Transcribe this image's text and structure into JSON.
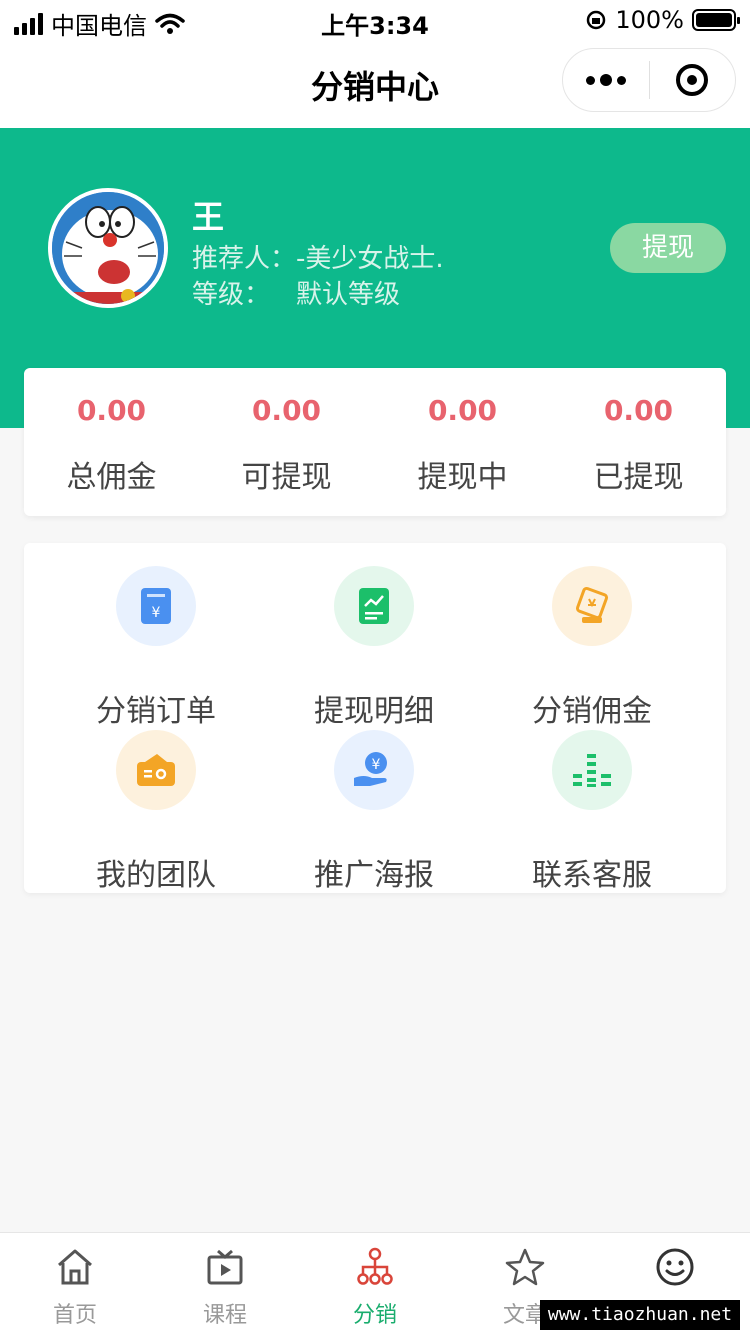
{
  "status_bar": {
    "carrier": "中国电信",
    "time": "上午3:34",
    "battery": "100%"
  },
  "nav": {
    "title": "分销中心"
  },
  "user": {
    "name": "王",
    "referrer_label": "推荐人：",
    "referrer": "-美少女战士.",
    "level_label": "等级：",
    "level": "默认等级",
    "withdraw_button": "提现"
  },
  "stats": [
    {
      "value": "0.00",
      "label": "总佣金"
    },
    {
      "value": "0.00",
      "label": "可提现"
    },
    {
      "value": "0.00",
      "label": "提现中"
    },
    {
      "value": "0.00",
      "label": "已提现"
    }
  ],
  "menu": [
    {
      "label": "分销订单",
      "icon": "order-yen-icon",
      "bg": "#e8f1fe",
      "color": "#4a90f0"
    },
    {
      "label": "提现明细",
      "icon": "chart-doc-icon",
      "bg": "#e4f7ec",
      "color": "#1cbf6a"
    },
    {
      "label": "分销佣金",
      "icon": "commission-card-icon",
      "bg": "#fdf1dd",
      "color": "#f3a526"
    },
    {
      "label": "我的团队",
      "icon": "wallet-icon",
      "bg": "#fdf1dd",
      "color": "#f3a526"
    },
    {
      "label": "推广海报",
      "icon": "hand-coin-icon",
      "bg": "#e8f1fe",
      "color": "#4a90f0"
    },
    {
      "label": "联系客服",
      "icon": "bars-icon",
      "bg": "#e4f7ec",
      "color": "#1cbf6a"
    }
  ],
  "tabs": [
    {
      "label": "首页",
      "icon": "home-icon"
    },
    {
      "label": "课程",
      "icon": "video-icon"
    },
    {
      "label": "分销",
      "icon": "distribution-tree-icon",
      "active": true
    },
    {
      "label": "文章",
      "icon": "star-icon"
    },
    {
      "label": "",
      "icon": "smile-icon"
    }
  ],
  "watermark": "www.tiaozhuan.net",
  "colors": {
    "header": "#0db98c",
    "value_red": "#e8636e",
    "tab_active": "#1aad6e"
  }
}
